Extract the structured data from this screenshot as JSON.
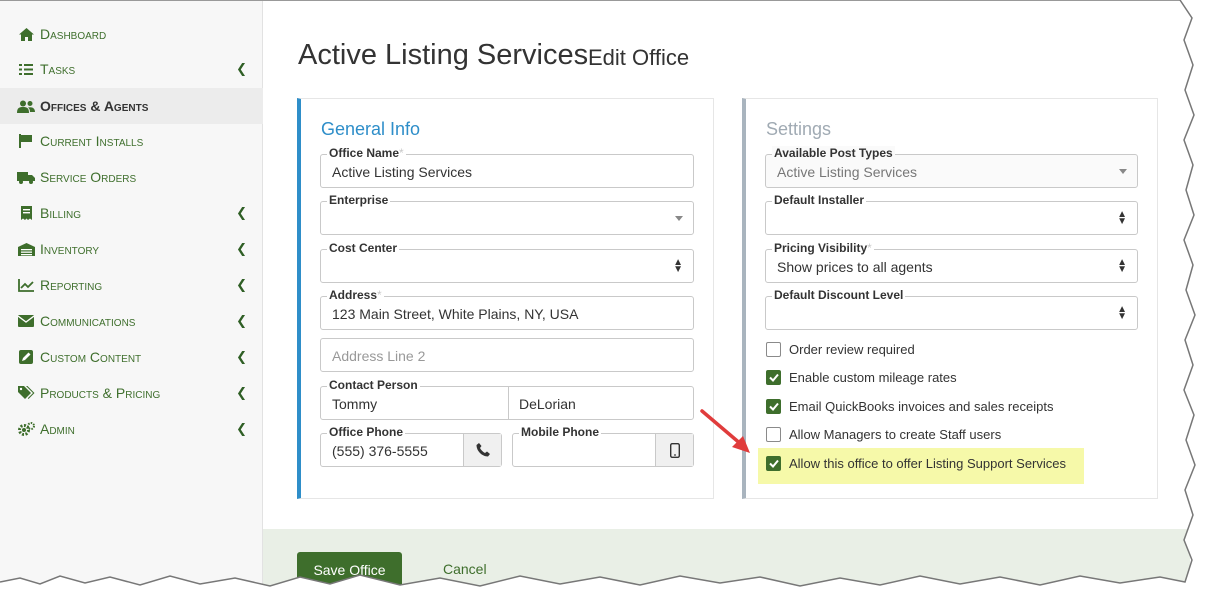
{
  "sidebar": {
    "items": [
      {
        "label": "Dashboard",
        "icon": "home-icon",
        "chevron": false,
        "active": false
      },
      {
        "label": "Tasks",
        "icon": "tasks-icon",
        "chevron": true,
        "active": false
      },
      {
        "label": "Offices & Agents",
        "icon": "users-icon",
        "chevron": false,
        "active": true
      },
      {
        "label": "Current Installs",
        "icon": "flag-icon",
        "chevron": false,
        "active": false
      },
      {
        "label": "Service Orders",
        "icon": "truck-icon",
        "chevron": false,
        "active": false
      },
      {
        "label": "Billing",
        "icon": "receipt-icon",
        "chevron": true,
        "active": false
      },
      {
        "label": "Inventory",
        "icon": "warehouse-icon",
        "chevron": true,
        "active": false
      },
      {
        "label": "Reporting",
        "icon": "line-chart-icon",
        "chevron": true,
        "active": false
      },
      {
        "label": "Communications",
        "icon": "envelope-icon",
        "chevron": true,
        "active": false
      },
      {
        "label": "Custom Content",
        "icon": "edit-icon",
        "chevron": true,
        "active": false
      },
      {
        "label": "Products & Pricing",
        "icon": "tags-icon",
        "chevron": true,
        "active": false
      },
      {
        "label": "Admin",
        "icon": "cogs-icon",
        "chevron": true,
        "active": false
      }
    ]
  },
  "page": {
    "title": "Active Listing Services",
    "subtitle": "Edit Office"
  },
  "general": {
    "title": "General Info",
    "office_name": {
      "label": "Office Name",
      "value": "Active Listing Services"
    },
    "enterprise": {
      "label": "Enterprise",
      "value": ""
    },
    "cost_center": {
      "label": "Cost Center",
      "value": ""
    },
    "address": {
      "label": "Address",
      "value": "123 Main Street, White Plains, NY, USA"
    },
    "address2": {
      "placeholder": "Address Line 2"
    },
    "contact": {
      "label": "Contact Person",
      "first": "Tommy",
      "last": "DeLorian"
    },
    "office_phone": {
      "label": "Office Phone",
      "value": "(555) 376-5555"
    },
    "mobile_phone": {
      "label": "Mobile Phone",
      "value": ""
    },
    "required_mark": "*"
  },
  "settings": {
    "title": "Settings",
    "post_types": {
      "label": "Available Post Types",
      "value": "Active Listing Services"
    },
    "installer": {
      "label": "Default Installer",
      "value": ""
    },
    "pricing": {
      "label": "Pricing Visibility",
      "value": "Show prices to all agents"
    },
    "discount": {
      "label": "Default Discount Level",
      "value": ""
    },
    "checks": [
      {
        "label": "Order review required",
        "checked": false
      },
      {
        "label": "Enable custom mileage rates",
        "checked": true
      },
      {
        "label": "Email QuickBooks invoices and sales receipts",
        "checked": true
      },
      {
        "label": "Allow Managers to create Staff users",
        "checked": false
      },
      {
        "label": "Allow this office to offer Listing Support Services",
        "checked": true
      }
    ]
  },
  "footer": {
    "save_label": "Save Office",
    "cancel_label": "Cancel"
  },
  "colors": {
    "brand_green": "#3e6e2c",
    "accent_blue": "#2e8ec9",
    "highlight": "#f6f9a9",
    "arrow_red": "#e03c3c"
  }
}
